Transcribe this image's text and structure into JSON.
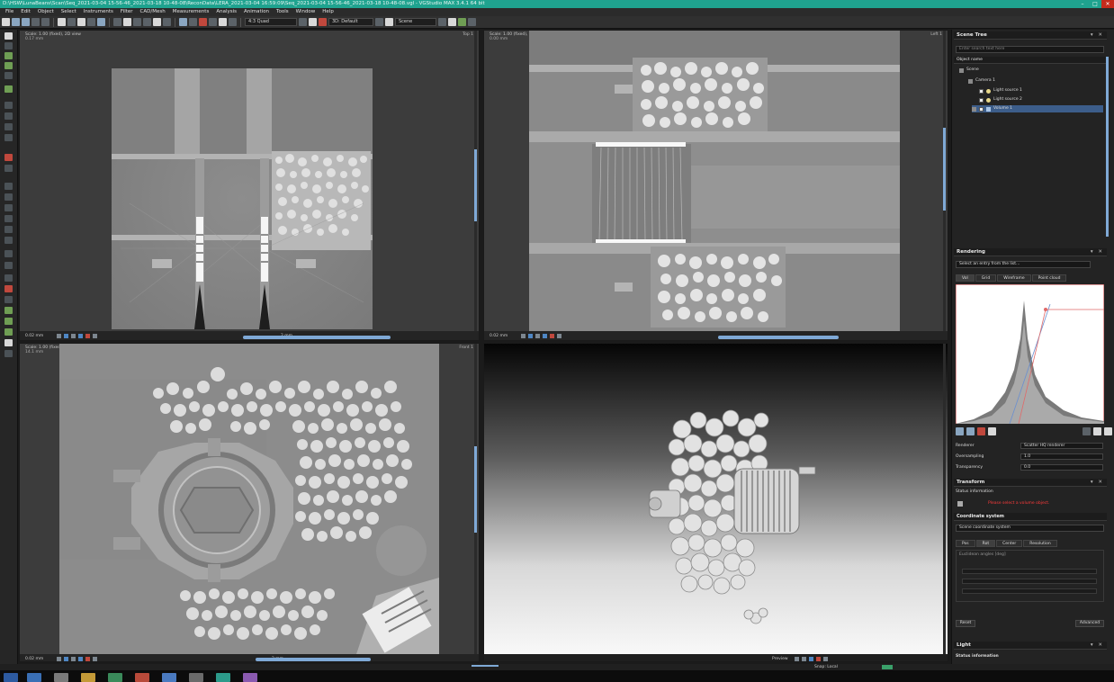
{
  "window": {
    "title": "D:\\HSW\\LunaBeans\\Scan\\Seq_2021-03-04 15-56-46_2021-03-18 10-48-08\\ReconData\\LERA_2021-03-04 16:59:09\\Seq_2021-03-04 15-56-46_2021-03-18 10-48-08.vgl - VGStudio MAX 3.4.1 64 bit",
    "minimize": "–",
    "maximize": "□",
    "close": "✕"
  },
  "menu": [
    "File",
    "Edit",
    "Object",
    "Select",
    "Instruments",
    "Filter",
    "CAD/Mesh",
    "Measurements",
    "Analysis",
    "Animation",
    "Tools",
    "Window",
    "Help"
  ],
  "toolbar": {
    "layout": "4:3 Quad",
    "view": "3D: Default",
    "scene": "Scene"
  },
  "viewports": {
    "top_left": {
      "label": "Scale: 1.00 (fixed), 2D view",
      "sub": "0.17 mm",
      "right": "Top 1",
      "zoom": "0.02 mm",
      "scale": "2 mm"
    },
    "top_right": {
      "label": "Scale: 1.00 (fixed), 2D view",
      "sub": "0.00 mm",
      "right": "Left 1",
      "zoom": "0.02 mm",
      "scale": ""
    },
    "bottom_left": {
      "label": "Scale: 1.00 (fixed), 2D view",
      "sub": "14.1 mm",
      "right": "Front 1",
      "zoom": "0.02 mm",
      "scale": "2 mm"
    },
    "bottom_right": {
      "label": "",
      "foot": "Preview"
    }
  },
  "scene_tree": {
    "title": "Scene Tree",
    "search_placeholder": "Enter search text here",
    "column": "Object name",
    "items": [
      {
        "label": "Scene",
        "level": 0,
        "icon": "globe"
      },
      {
        "label": "Camera 1",
        "level": 1,
        "icon": "camera"
      },
      {
        "label": "Light source 1",
        "level": 2,
        "icon": "bulb"
      },
      {
        "label": "Light source 2",
        "level": 2,
        "icon": "bulb"
      },
      {
        "label": "Volume 1",
        "level": 1,
        "icon": "volume",
        "selected": true
      }
    ]
  },
  "rendering": {
    "title": "Rendering",
    "hint": "Select an entry from the list...",
    "tabs": [
      "Vol",
      "Grid",
      "Wireframe",
      "Point cloud"
    ],
    "renderer_label": "Renderer",
    "renderer_value": "Scatter HQ renderer",
    "oversampling_label": "Oversampling",
    "oversampling_value": "1.0",
    "transparency_label": "Transparency",
    "transparency_value": "0.0"
  },
  "transform": {
    "title": "Transform",
    "status_label": "Status information",
    "status_text": "Please select a volume object.",
    "coord_title": "Coordinate system",
    "coord_value": "Scene coordinate system",
    "tabs": [
      "Pos",
      "Rot",
      "Center",
      "Resolution"
    ],
    "rot_label": "Euclidean angles [deg]",
    "reset": "Reset",
    "advanced": "Advanced"
  },
  "light": {
    "title": "Light",
    "status_label": "Status information"
  },
  "status": {
    "snap": "Snap: Local"
  },
  "colors": {
    "titlebar": "#1fa38f",
    "accent": "#7fa9d6",
    "status_red": "#ff3b3b"
  }
}
